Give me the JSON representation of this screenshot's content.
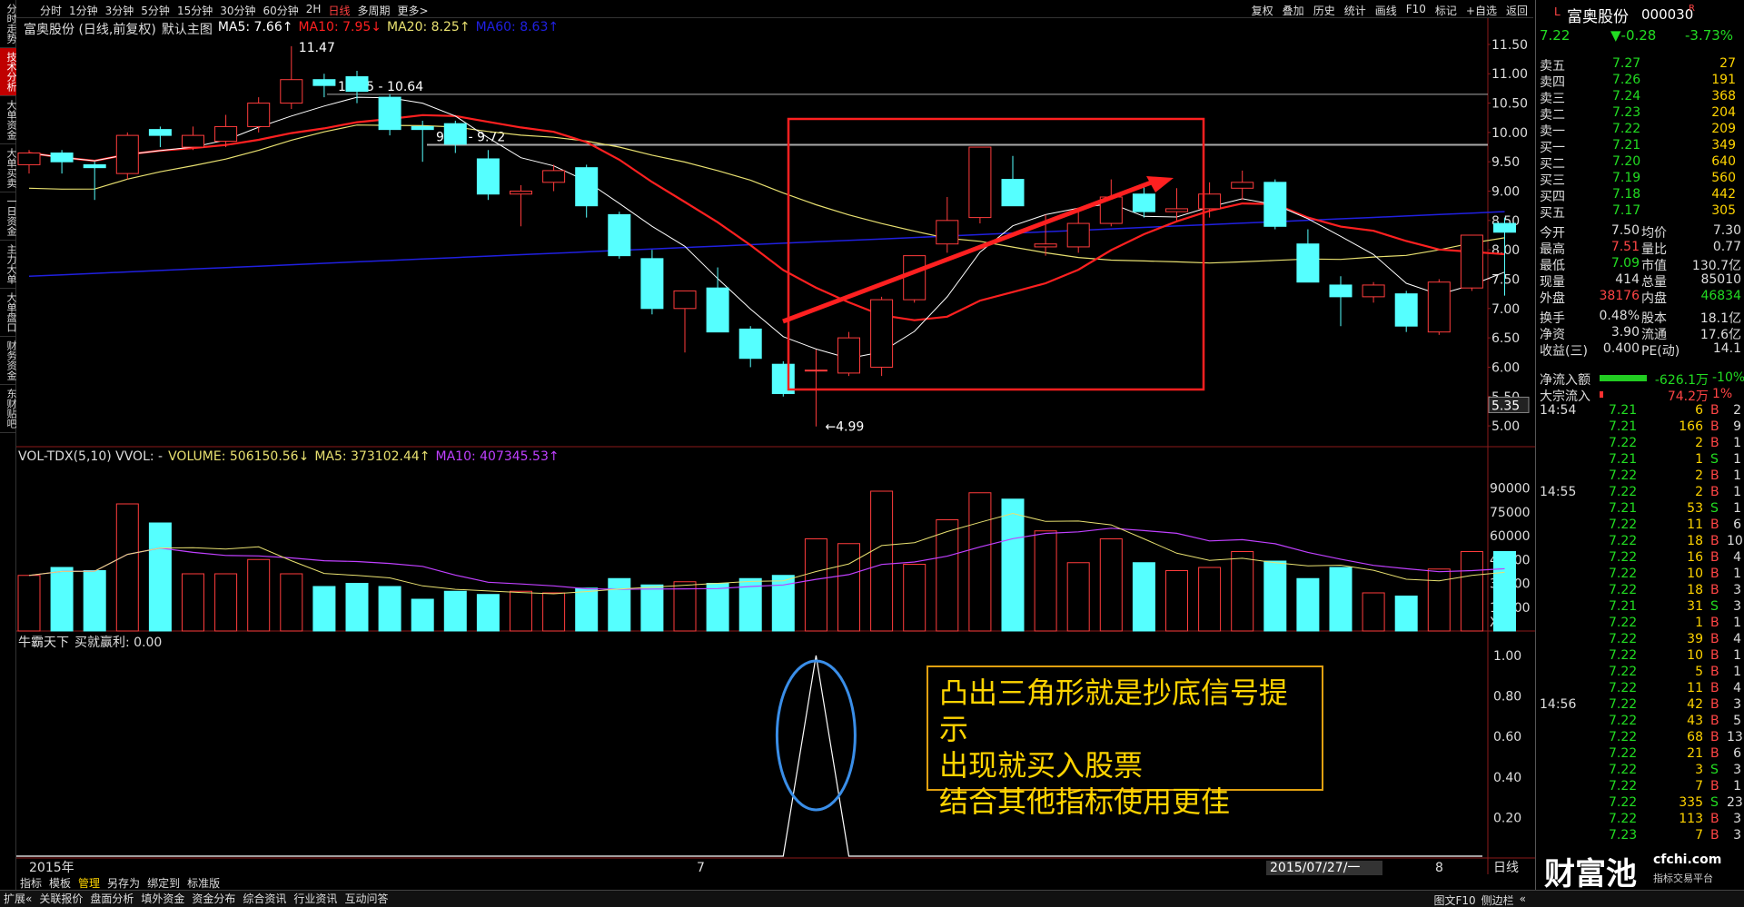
{
  "left_tabs": [
    "分时走势",
    "技术分析",
    "大单资金",
    "大单买卖",
    "一日资金",
    "主力大单",
    "大单盘口",
    "财务资金",
    "东财贴吧"
  ],
  "left_tab_active": 1,
  "periods": [
    "分时",
    "1分钟",
    "3分钟",
    "5分钟",
    "15分钟",
    "30分钟",
    "60分钟",
    "2H",
    "日线",
    "多周期",
    "更多>"
  ],
  "period_active": "日线",
  "right_tools": [
    "复权",
    "叠加",
    "历史",
    "统计",
    "画线",
    "F10",
    "标记",
    "+自选",
    "返回"
  ],
  "main_header": {
    "stock": "富奥股份 (日线,前复权)",
    "template": "默认主图",
    "ma5": "MA5: 7.66↑",
    "ma10": "MA10: 7.95↓",
    "ma20": "MA20: 8.25↑",
    "ma60": "MA60: 8.63↑"
  },
  "vol_header": {
    "name": "VOL-TDX(5,10) VVOL: -",
    "volume": "VOLUME: 506150.56↓",
    "ma5": "MA5: 373102.44↑",
    "ma10": "MA10: 407345.53↑"
  },
  "ind_header": {
    "name": "牛霸天下",
    "val": "买就赢利: 0.00"
  },
  "price_axis": [
    "11.50",
    "11.00",
    "10.50",
    "10.00",
    "9.50",
    "9.00",
    "8.50",
    "8.00",
    "7.50",
    "7.00",
    "6.50",
    "6.00",
    "5.50",
    "5.00"
  ],
  "price_tag": "5.35",
  "vol_axis": [
    "90000",
    "75000",
    "60000",
    "45000",
    "30000",
    "15000",
    "X10"
  ],
  "ind_axis": [
    "1.00",
    "0.80",
    "0.60",
    "0.40",
    "0.20"
  ],
  "annotations": {
    "high": "11.47",
    "low": "4.99",
    "line1": "10.65 - 10.64",
    "line2": "9.79 - 9.72"
  },
  "x_labels": {
    "year": "2015年",
    "mid": "7",
    "date": "2015/07/27/一",
    "right": "8"
  },
  "period_box": "日线",
  "note_lines": [
    "凸出三角形就是抄底信号提示",
    "出现就买入股票",
    "结合其他指标使用更佳"
  ],
  "colors": {
    "up": "#ff3c3c",
    "down": "#55ffff",
    "ma5": "#ffffff",
    "ma10": "#ff2020",
    "ma20": "#e8e070",
    "ma60": "#2020e0",
    "note": "#ffd400",
    "ellipse": "#3a8ee8"
  },
  "chart_data": {
    "type": "candlestick",
    "candles": [
      {
        "o": 9.45,
        "c": 9.65,
        "h": 9.7,
        "l": 9.3
      },
      {
        "o": 9.65,
        "c": 9.5,
        "h": 9.7,
        "l": 9.3
      },
      {
        "o": 9.45,
        "c": 9.4,
        "h": 9.5,
        "l": 8.85
      },
      {
        "o": 9.3,
        "c": 9.95,
        "h": 10.0,
        "l": 9.2
      },
      {
        "o": 10.05,
        "c": 9.95,
        "h": 10.1,
        "l": 9.75
      },
      {
        "o": 9.75,
        "c": 9.95,
        "h": 10.1,
        "l": 9.7
      },
      {
        "o": 9.85,
        "c": 10.1,
        "h": 10.3,
        "l": 9.75
      },
      {
        "o": 10.1,
        "c": 10.5,
        "h": 10.6,
        "l": 10.0
      },
      {
        "o": 10.5,
        "c": 10.9,
        "h": 11.47,
        "l": 10.4
      },
      {
        "o": 10.9,
        "c": 10.8,
        "h": 11.0,
        "l": 10.6
      },
      {
        "o": 10.95,
        "c": 10.7,
        "h": 11.05,
        "l": 10.5
      },
      {
        "o": 10.6,
        "c": 10.05,
        "h": 10.65,
        "l": 9.95
      },
      {
        "o": 10.1,
        "c": 10.05,
        "h": 10.2,
        "l": 9.5
      },
      {
        "o": 10.15,
        "c": 9.8,
        "h": 10.2,
        "l": 9.65
      },
      {
        "o": 9.55,
        "c": 8.95,
        "h": 9.7,
        "l": 8.85
      },
      {
        "o": 8.95,
        "c": 9.0,
        "h": 9.1,
        "l": 8.4
      },
      {
        "o": 9.15,
        "c": 9.35,
        "h": 9.45,
        "l": 9.0
      },
      {
        "o": 9.4,
        "c": 8.75,
        "h": 9.45,
        "l": 8.55
      },
      {
        "o": 8.6,
        "c": 7.9,
        "h": 8.65,
        "l": 7.85
      },
      {
        "o": 7.85,
        "c": 7.0,
        "h": 8.0,
        "l": 6.9
      },
      {
        "o": 7.0,
        "c": 7.3,
        "h": 7.3,
        "l": 6.25
      },
      {
        "o": 7.35,
        "c": 6.6,
        "h": 7.7,
        "l": 6.6
      },
      {
        "o": 6.65,
        "c": 6.15,
        "h": 6.7,
        "l": 6.0
      },
      {
        "o": 6.05,
        "c": 5.55,
        "h": 6.1,
        "l": 5.5
      },
      {
        "o": 5.95,
        "c": 5.95,
        "h": 6.3,
        "l": 4.99
      },
      {
        "o": 5.9,
        "c": 6.5,
        "h": 6.6,
        "l": 5.85
      },
      {
        "o": 6.0,
        "c": 7.15,
        "h": 7.2,
        "l": 5.85
      },
      {
        "o": 7.15,
        "c": 7.9,
        "h": 7.9,
        "l": 7.1
      },
      {
        "o": 8.1,
        "c": 8.5,
        "h": 8.9,
        "l": 7.95
      },
      {
        "o": 8.55,
        "c": 9.75,
        "h": 9.75,
        "l": 8.45
      },
      {
        "o": 9.2,
        "c": 8.75,
        "h": 9.6,
        "l": 8.75
      },
      {
        "o": 8.05,
        "c": 8.1,
        "h": 8.6,
        "l": 7.9
      },
      {
        "o": 8.05,
        "c": 8.45,
        "h": 8.65,
        "l": 7.95
      },
      {
        "o": 8.45,
        "c": 8.9,
        "h": 9.2,
        "l": 8.4
      },
      {
        "o": 8.95,
        "c": 8.65,
        "h": 9.1,
        "l": 8.55
      },
      {
        "o": 8.65,
        "c": 8.7,
        "h": 9.05,
        "l": 8.5
      },
      {
        "o": 8.7,
        "c": 8.95,
        "h": 9.15,
        "l": 8.55
      },
      {
        "o": 9.05,
        "c": 9.15,
        "h": 9.35,
        "l": 8.85
      },
      {
        "o": 9.15,
        "c": 8.4,
        "h": 9.2,
        "l": 8.35
      },
      {
        "o": 8.1,
        "c": 7.45,
        "h": 8.35,
        "l": 7.45
      },
      {
        "o": 7.4,
        "c": 7.2,
        "h": 7.55,
        "l": 6.7
      },
      {
        "o": 7.2,
        "c": 7.4,
        "h": 7.45,
        "l": 7.1
      },
      {
        "o": 7.25,
        "c": 6.7,
        "h": 7.3,
        "l": 6.6
      },
      {
        "o": 6.6,
        "c": 7.45,
        "h": 7.5,
        "l": 6.55
      },
      {
        "o": 7.35,
        "c": 8.25,
        "h": 8.25,
        "l": 7.3
      },
      {
        "o": 8.45,
        "c": 8.3,
        "h": 8.55,
        "l": 7.22
      }
    ],
    "volume": [
      35000,
      40000,
      38000,
      80000,
      68000,
      36000,
      36000,
      45000,
      36000,
      28000,
      30000,
      28000,
      20000,
      25000,
      23000,
      25000,
      24000,
      27000,
      33000,
      29000,
      31000,
      30000,
      33000,
      35000,
      58000,
      55000,
      88000,
      42000,
      70000,
      87000,
      83000,
      63000,
      43000,
      58000,
      43000,
      38000,
      40000,
      50000,
      44000,
      33000,
      40000,
      24000,
      22000,
      39000,
      50000,
      50000
    ],
    "indicator": {
      "value": 1.0,
      "bar_index": 24
    },
    "price_range": [
      4.8,
      11.7
    ],
    "vol_range": [
      0,
      100000
    ]
  },
  "quote": {
    "name": "富奥股份",
    "code": "000030",
    "flag": "R",
    "price": "7.22",
    "change": "▼-0.28",
    "pct": "-3.73%",
    "asks": [
      [
        "卖五",
        "7.27",
        "27"
      ],
      [
        "卖四",
        "7.26",
        "191"
      ],
      [
        "卖三",
        "7.24",
        "368"
      ],
      [
        "卖二",
        "7.23",
        "204"
      ],
      [
        "卖一",
        "7.22",
        "209"
      ]
    ],
    "bids": [
      [
        "买一",
        "7.21",
        "349"
      ],
      [
        "买二",
        "7.20",
        "640"
      ],
      [
        "买三",
        "7.19",
        "560"
      ],
      [
        "买四",
        "7.18",
        "442"
      ],
      [
        "买五",
        "7.17",
        "305"
      ]
    ],
    "stats": [
      [
        "今开",
        "7.50",
        "均价",
        "7.30"
      ],
      [
        "最高",
        "7.51",
        "量比",
        "0.77"
      ],
      [
        "最低",
        "7.09",
        "市值",
        "130.7亿"
      ],
      [
        "现量",
        "414",
        "总量",
        "85010"
      ],
      [
        "外盘",
        "38176",
        "内盘",
        "46834"
      ],
      [
        "换手",
        "0.48%",
        "股本",
        "18.1亿"
      ],
      [
        "净资",
        "3.90",
        "流通",
        "17.6亿"
      ],
      [
        "收益(三)",
        "0.400",
        "PE(动)",
        "14.1"
      ]
    ],
    "flow": [
      [
        "净流入额",
        "-626.1万",
        "-10%"
      ],
      [
        "大宗流入",
        "74.2万",
        "1%"
      ]
    ],
    "ticks": [
      [
        "14:54",
        "7.21",
        "6",
        "B",
        "2"
      ],
      [
        "",
        "7.21",
        "166",
        "B",
        "9"
      ],
      [
        "",
        "7.22",
        "2",
        "B",
        "1"
      ],
      [
        "",
        "7.21",
        "1",
        "S",
        "1"
      ],
      [
        "",
        "7.22",
        "2",
        "B",
        "1"
      ],
      [
        "14:55",
        "7.22",
        "2",
        "B",
        "1"
      ],
      [
        "",
        "7.21",
        "53",
        "S",
        "1"
      ],
      [
        "",
        "7.22",
        "11",
        "B",
        "6"
      ],
      [
        "",
        "7.22",
        "18",
        "B",
        "10"
      ],
      [
        "",
        "7.22",
        "16",
        "B",
        "4"
      ],
      [
        "",
        "7.22",
        "10",
        "B",
        "1"
      ],
      [
        "",
        "7.22",
        "18",
        "B",
        "3"
      ],
      [
        "",
        "7.21",
        "31",
        "S",
        "3"
      ],
      [
        "",
        "7.22",
        "1",
        "B",
        "1"
      ],
      [
        "",
        "7.22",
        "39",
        "B",
        "4"
      ],
      [
        "",
        "7.22",
        "10",
        "B",
        "1"
      ],
      [
        "",
        "7.22",
        "5",
        "B",
        "1"
      ],
      [
        "",
        "7.22",
        "11",
        "B",
        "4"
      ],
      [
        "14:56",
        "7.22",
        "42",
        "B",
        "3"
      ],
      [
        "",
        "7.22",
        "43",
        "B",
        "5"
      ],
      [
        "",
        "7.22",
        "68",
        "B",
        "13"
      ],
      [
        "",
        "7.22",
        "21",
        "B",
        "6"
      ],
      [
        "",
        "7.22",
        "3",
        "S",
        "3"
      ],
      [
        "",
        "7.22",
        "7",
        "B",
        "1"
      ],
      [
        "",
        "7.22",
        "335",
        "S",
        "23"
      ],
      [
        "",
        "7.22",
        "113",
        "B",
        "3"
      ],
      [
        "",
        "7.23",
        "7",
        "B",
        "3"
      ]
    ]
  },
  "bottom_tabs": [
    "指标",
    "模板",
    "管理",
    "另存为",
    "绑定到",
    "标准版"
  ],
  "bottom_active": "管理",
  "footer_items": [
    "扩展«",
    "关联报价",
    "盘面分析",
    "填外资金",
    "资金分布",
    "综合资讯",
    "行业资讯",
    "互动问答"
  ],
  "footer_right": [
    "图文F10",
    "侧边栏",
    "«"
  ],
  "logo": {
    "big": "财富池",
    "site": "cfchi.com",
    "sub": "指标交易平台"
  }
}
